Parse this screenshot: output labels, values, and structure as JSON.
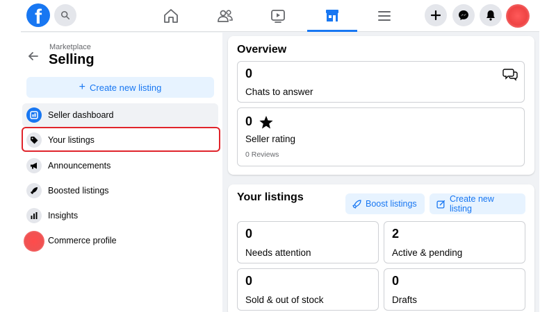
{
  "topbar": {
    "logo": "f",
    "icons": [
      "facebook-logo",
      "search-icon",
      "home-icon",
      "friends-icon",
      "watch-icon",
      "marketplace-icon",
      "menu-icon",
      "plus-icon",
      "messenger-icon",
      "notifications-icon",
      "avatar"
    ],
    "active_tab": "marketplace"
  },
  "sidebar": {
    "breadcrumb": "Marketplace",
    "title": "Selling",
    "create_button": "Create new listing",
    "items": [
      {
        "label": "Seller dashboard",
        "icon": "dashboard-icon"
      },
      {
        "label": "Your listings",
        "icon": "tag-icon"
      },
      {
        "label": "Announcements",
        "icon": "megaphone-icon"
      },
      {
        "label": "Boosted listings",
        "icon": "rocket-icon"
      },
      {
        "label": "Insights",
        "icon": "bar-chart-icon"
      },
      {
        "label": "Commerce profile",
        "icon": "profile-icon"
      }
    ]
  },
  "overview": {
    "title": "Overview",
    "chats": {
      "value": "0",
      "label": "Chats to answer"
    },
    "rating": {
      "value": "0",
      "label": "Seller rating",
      "sub": "0 Reviews"
    }
  },
  "listings": {
    "title": "Your listings",
    "boost_button": "Boost listings",
    "create_button": "Create new listing",
    "cards": [
      {
        "value": "0",
        "label": "Needs attention"
      },
      {
        "value": "2",
        "label": "Active & pending"
      },
      {
        "value": "0",
        "label": "Sold & out of stock"
      },
      {
        "value": "0",
        "label": "Drafts"
      }
    ]
  },
  "colors": {
    "accent": "#1877f2",
    "highlight": "#e0242b",
    "background": "#f0f2f5"
  }
}
